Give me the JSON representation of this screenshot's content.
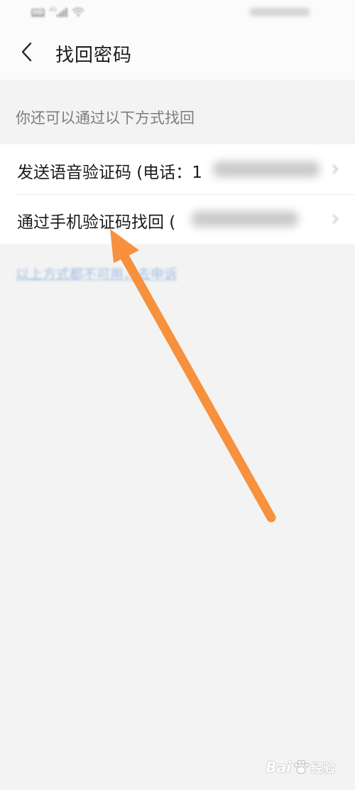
{
  "status_bar": {
    "hd_label": "HD",
    "network_label": "4G"
  },
  "header": {
    "title": "找回密码"
  },
  "section": {
    "hint": "你还可以通过以下方式找回"
  },
  "options": [
    {
      "label": "发送语音验证码 (电话：1"
    },
    {
      "label": "通过手机验证码找回 ("
    }
  ],
  "link": {
    "text": "以上方式都不可用，去申诉"
  },
  "watermark": {
    "brand": "Bai",
    "suffix": "经验"
  },
  "colors": {
    "background": "#f3f3f3",
    "card": "#ffffff",
    "link": "#5b8fd6",
    "annotation_arrow": "#f7913d"
  }
}
